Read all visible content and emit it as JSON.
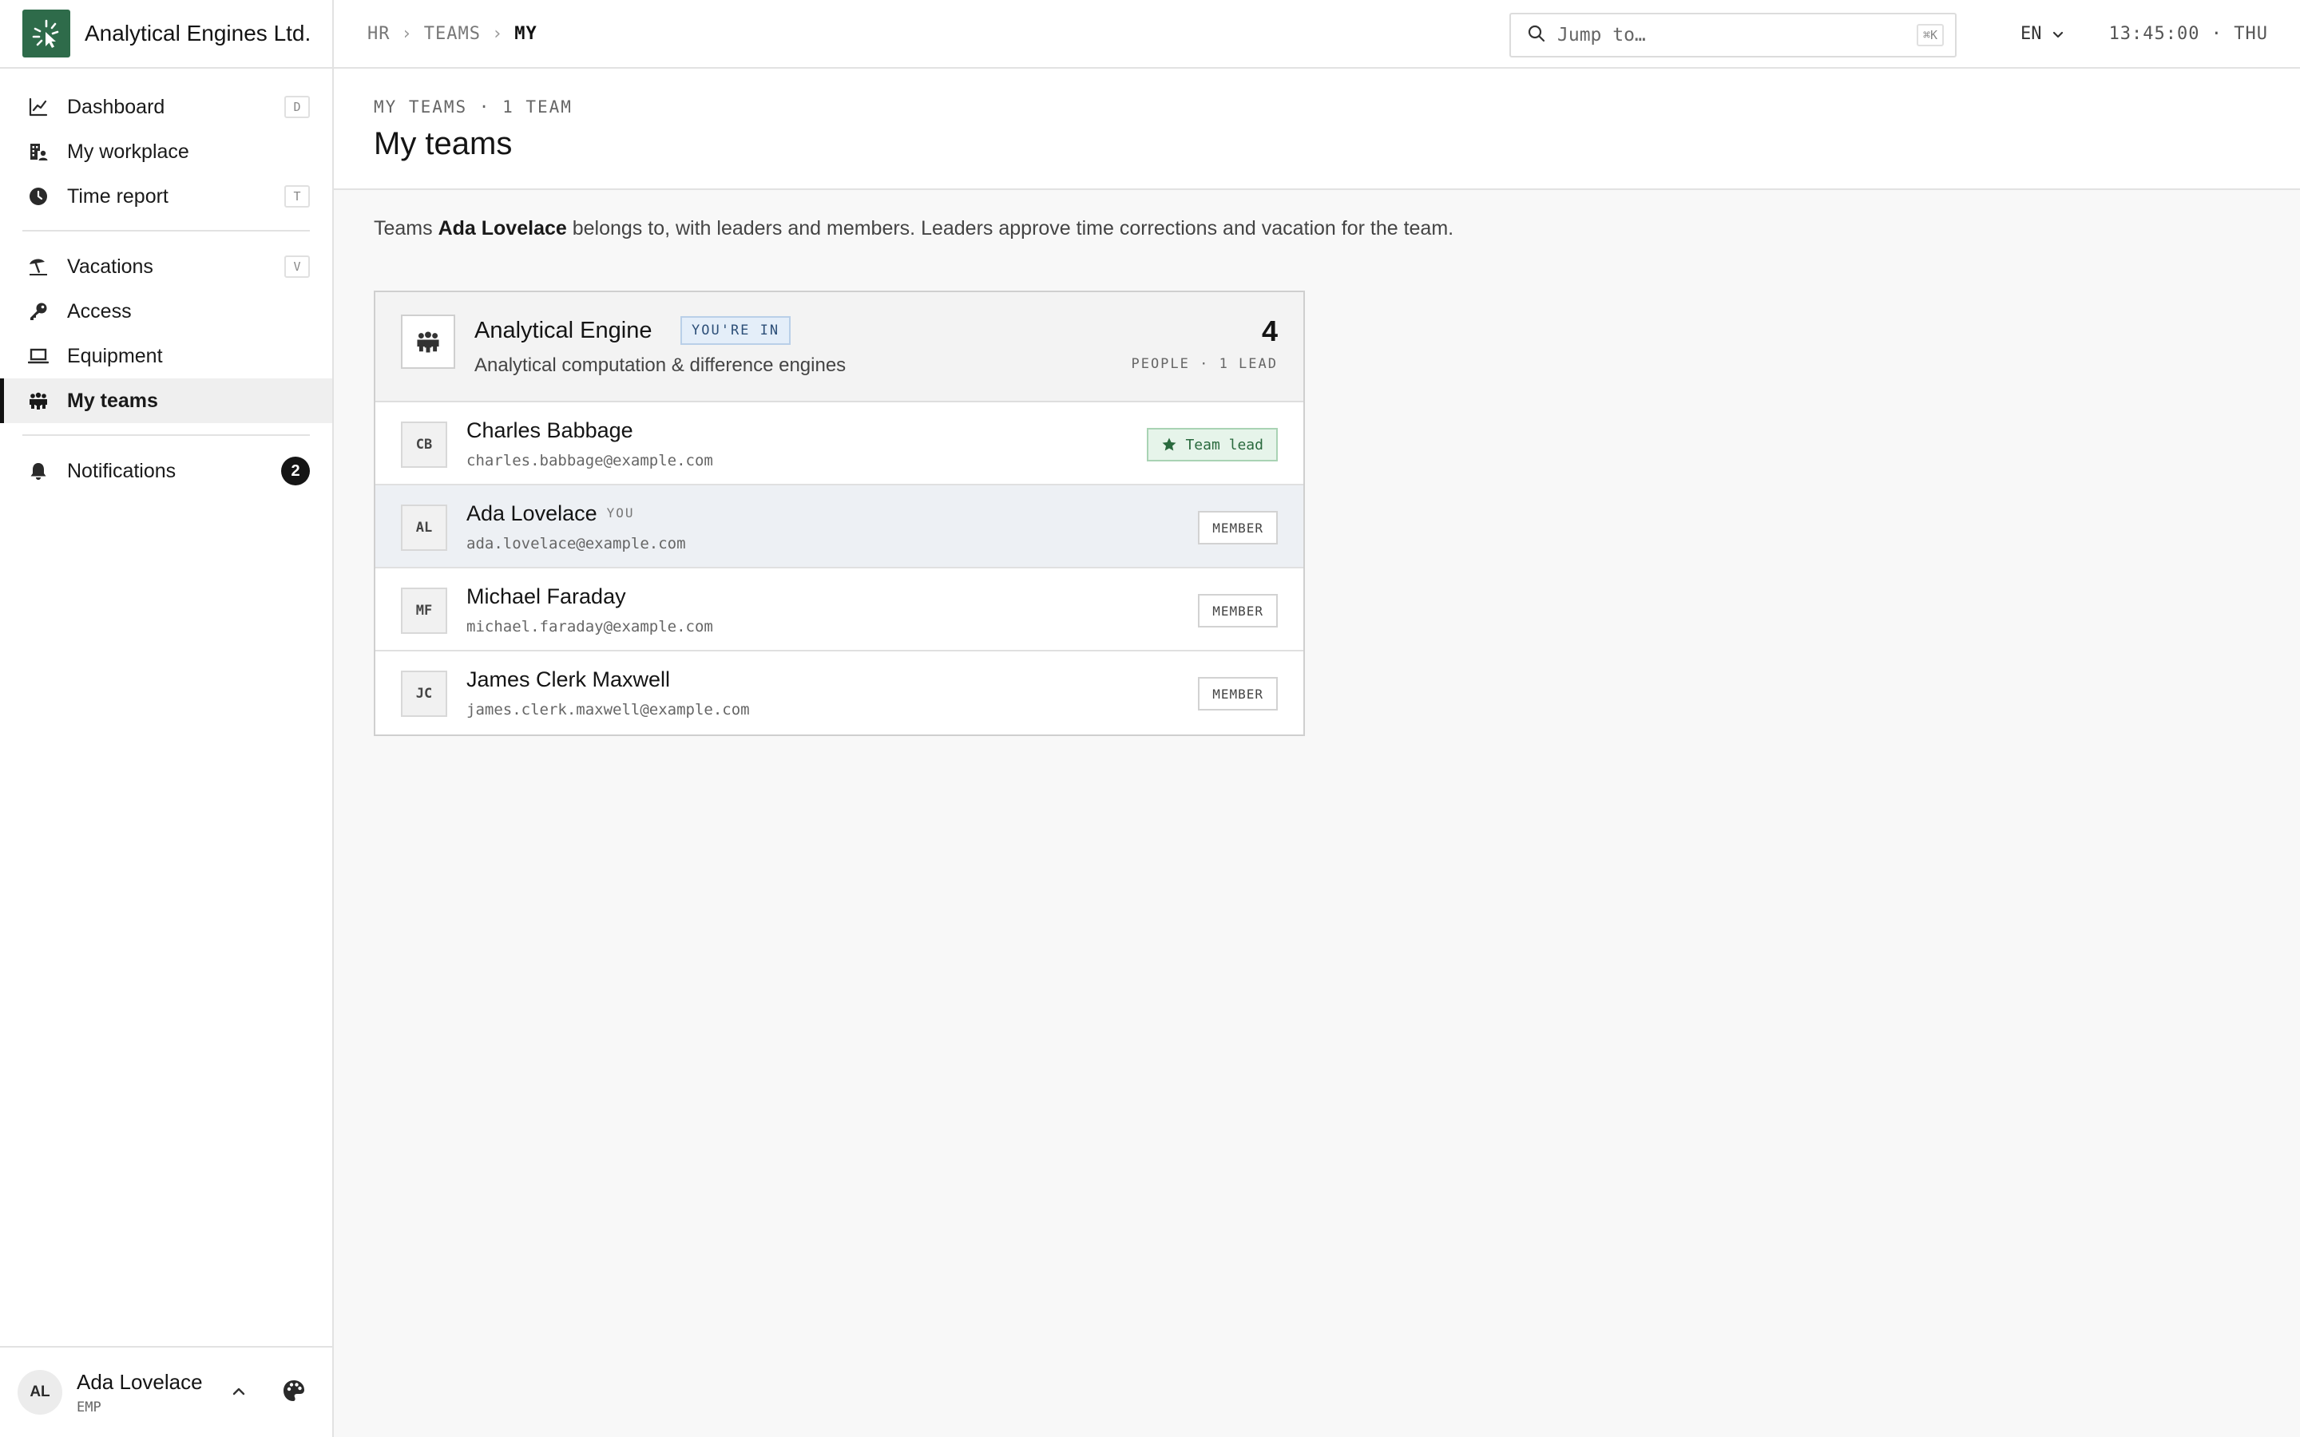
{
  "brand": {
    "name": "Analytical Engines Ltd.",
    "logo_icon": "cursor-burst-logo",
    "color": "#2e6b4a"
  },
  "sidebar": {
    "groups": [
      [
        {
          "label": "Dashboard",
          "icon": "chart-line-icon",
          "shortcut": "D"
        },
        {
          "label": "My workplace",
          "icon": "building-person-icon",
          "shortcut": ""
        },
        {
          "label": "Time report",
          "icon": "clock-icon",
          "shortcut": "T"
        }
      ],
      [
        {
          "label": "Vacations",
          "icon": "beach-umbrella-icon",
          "shortcut": "V"
        },
        {
          "label": "Access",
          "icon": "key-icon",
          "shortcut": ""
        },
        {
          "label": "Equipment",
          "icon": "laptop-icon",
          "shortcut": ""
        },
        {
          "label": "My teams",
          "icon": "people-group-icon",
          "shortcut": "",
          "active": true
        }
      ],
      [
        {
          "label": "Notifications",
          "icon": "bell-icon",
          "badge": "2"
        }
      ]
    ],
    "user": {
      "initials": "AL",
      "name": "Ada Lovelace",
      "role": "EMP"
    }
  },
  "topbar": {
    "breadcrumb": [
      "HR",
      "TEAMS",
      "MY"
    ],
    "search": {
      "placeholder": "Jump to…",
      "shortcut": "⌘K"
    },
    "language": "EN",
    "clock": "13:45:00 · THU"
  },
  "page": {
    "eyebrow": "MY TEAMS · 1 TEAM",
    "title": "My teams",
    "intro_prefix": "Teams ",
    "intro_user": "Ada Lovelace",
    "intro_suffix": " belongs to, with leaders and members. Leaders approve time corrections and vacation for the team."
  },
  "team": {
    "name": "Analytical Engine",
    "tag": "YOU'RE IN",
    "description": "Analytical computation & difference engines",
    "count": "4",
    "count_label": "PEOPLE · 1 LEAD",
    "members": [
      {
        "initials": "CB",
        "name": "Charles Babbage",
        "email": "charles.babbage@example.com",
        "role": "Team lead",
        "you": ""
      },
      {
        "initials": "AL",
        "name": "Ada Lovelace",
        "email": "ada.lovelace@example.com",
        "role": "MEMBER",
        "you": "YOU"
      },
      {
        "initials": "MF",
        "name": "Michael Faraday",
        "email": "michael.faraday@example.com",
        "role": "MEMBER",
        "you": ""
      },
      {
        "initials": "JC",
        "name": "James Clerk Maxwell",
        "email": "james.clerk.maxwell@example.com",
        "role": "MEMBER",
        "you": ""
      }
    ]
  }
}
